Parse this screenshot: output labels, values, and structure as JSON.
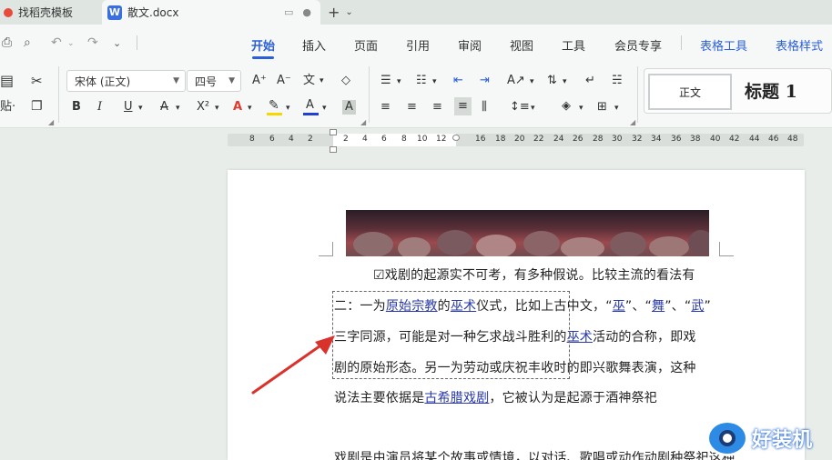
{
  "tabs": {
    "tab1_label": "找稻壳模板",
    "tab2_label": "散文.docx",
    "word_logo": "W"
  },
  "menu": {
    "items": [
      "开始",
      "插入",
      "页面",
      "引用",
      "审阅",
      "视图",
      "工具",
      "会员专享"
    ],
    "active": "开始",
    "context_items": [
      "表格工具",
      "表格样式"
    ]
  },
  "ribbon": {
    "font_name": "宋体 (正文)",
    "font_size": "四号",
    "style_normal": "正文",
    "style_heading1": "标题  1",
    "format_bold": "B",
    "format_italic": "I",
    "format_underline": "U",
    "format_strike": "A",
    "format_super": "X²",
    "text_effect": "A",
    "font_color": "A",
    "char_shade": "A",
    "grow_font": "A⁺",
    "shrink_font": "A⁻",
    "phonetic": "文",
    "clear_format": "◇"
  },
  "ruler": {
    "numbers": [
      "8",
      "6",
      "4",
      "2",
      "2",
      "4",
      "6",
      "8",
      "10",
      "12",
      "16",
      "18",
      "20",
      "22",
      "24",
      "26",
      "28",
      "30",
      "32",
      "34",
      "36",
      "38",
      "40",
      "42",
      "44",
      "46",
      "48"
    ]
  },
  "document": {
    "line1": "☑戏剧的起源实不可考，有多种假说。比较主流的看法有",
    "line2_pre": "二：一为",
    "line2_link1": "原始宗教",
    "line2_mid1": "的",
    "line2_link2": "巫术",
    "line2_mid2": "仪式，比如上古中文，“",
    "line2_link3": "巫",
    "line2_mid3": "”、“",
    "line2_link4": "舞",
    "line2_mid4": "”、“",
    "line2_link5": "武",
    "line2_post": "”",
    "line3_pre": "三字同源，可能是对一种乞求战斗胜利的",
    "line3_link": "巫术",
    "line3_post": "活动的合称，即戏",
    "line4": "剧的原始形态。另一为劳动或庆祝丰收时的即兴歌舞表演，这种",
    "line5_pre": "说法主要依据是",
    "line5_link": "古希腊戏剧",
    "line5_post": "，它被认为是起源于酒神祭祀",
    "line6": "戏剧是由演员将某个故事或情境，以对话、歌唱或动作动剧种祭祀这种"
  },
  "watermark": {
    "text": "好装机"
  },
  "colors": {
    "accent": "#2b5fd9",
    "link": "#2a3aa8",
    "arrow": "#d9322c",
    "highlight_yellow": "#f5d800",
    "font_color_blue": "#1f3fd1",
    "text_effect_red": "#e03b2e"
  }
}
